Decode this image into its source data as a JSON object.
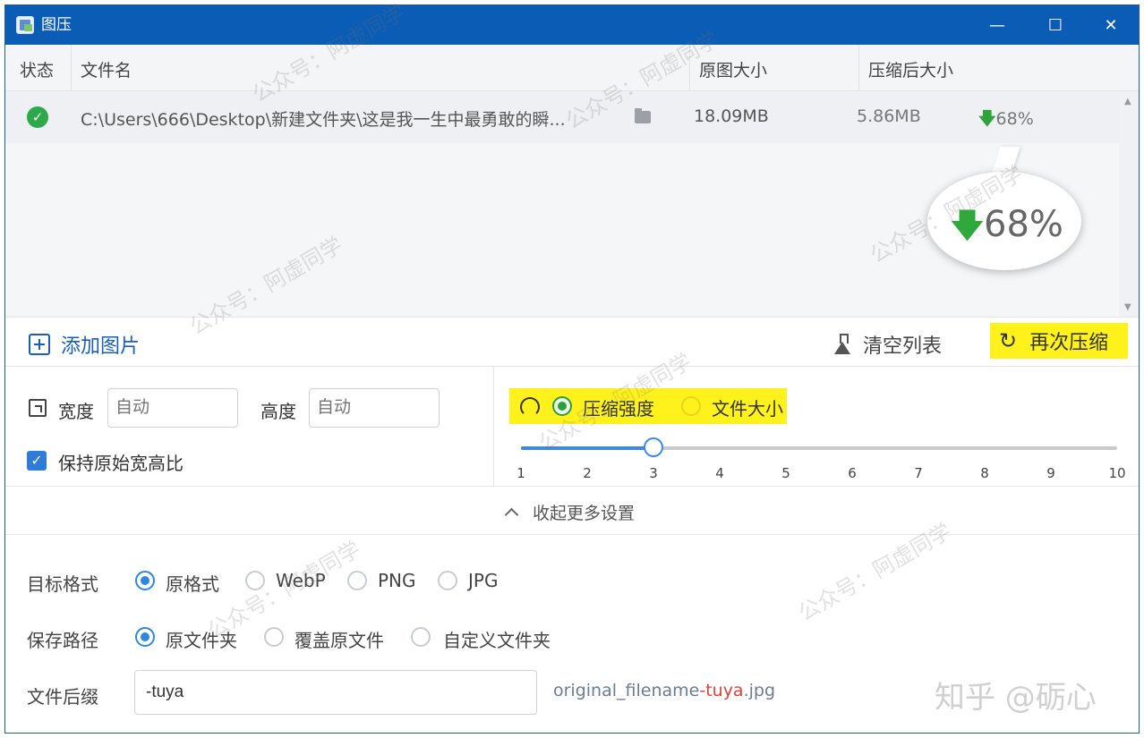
{
  "window": {
    "title": "图压",
    "minimize_glyph": "—",
    "maximize_glyph": "☐",
    "close_glyph": "✕"
  },
  "table": {
    "columns": [
      "状态",
      "文件名",
      "原图大小",
      "压缩后大小"
    ],
    "rows": [
      {
        "status_glyph": "✓",
        "filename": "C:\\Users\\666\\Desktop\\新建文件夹\\这是我一生中最勇敢的瞬...",
        "original_size": "18.09MB",
        "compressed_size": "5.86MB",
        "ratio": "68%"
      }
    ]
  },
  "callout": {
    "ratio": "68%"
  },
  "toolbar": {
    "add_label": "添加图片",
    "clear_label": "清空列表",
    "recompress_label": "再次压缩",
    "recompress_glyph": "↻"
  },
  "dimensions": {
    "width_label": "宽度",
    "width_placeholder": "自动",
    "height_label": "高度",
    "height_placeholder": "自动",
    "keep_ratio_label": "保持原始宽高比",
    "keep_ratio_glyph": "✓"
  },
  "mode": {
    "strength_label": "压缩强度",
    "size_label": "文件大小",
    "selected": "压缩强度"
  },
  "slider": {
    "ticks": [
      "1",
      "2",
      "3",
      "4",
      "5",
      "6",
      "7",
      "8",
      "9",
      "10"
    ],
    "value": 3
  },
  "collapse": {
    "label": "收起更多设置"
  },
  "format": {
    "label": "目标格式",
    "options": [
      "原格式",
      "WebP",
      "PNG",
      "JPG"
    ],
    "selected": "原格式"
  },
  "save_path": {
    "label": "保存路径",
    "options": [
      "原文件夹",
      "覆盖原文件",
      "自定义文件夹"
    ],
    "selected": "原文件夹"
  },
  "suffix": {
    "label": "文件后缀",
    "value": "-tuya",
    "preview_prefix": "original_filename",
    "preview_suffix": "-tuya",
    "preview_ext": ".jpg"
  },
  "watermarks": {
    "wechat": "公众号：阿虚同学",
    "brand": "知乎 @砺心"
  },
  "colors": {
    "titlebar": "#0a5cb5",
    "accent": "#2f86dd",
    "highlight": "#fff21c",
    "success": "#2ea94a"
  }
}
